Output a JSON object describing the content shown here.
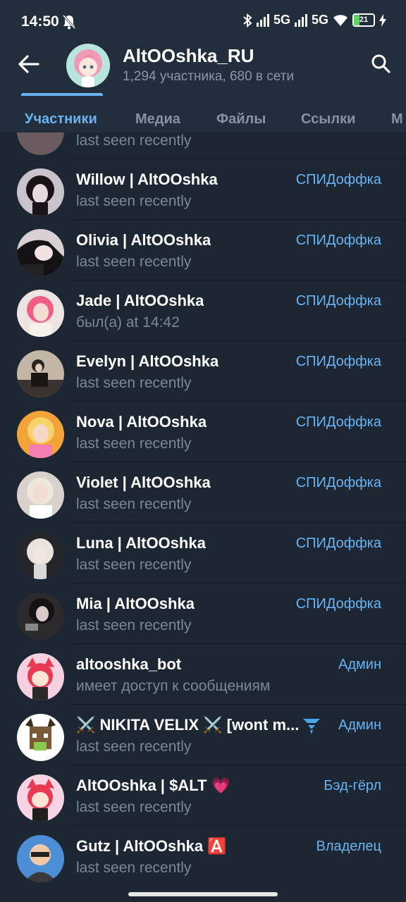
{
  "status_bar": {
    "time": "14:50",
    "network_1": "5G",
    "network_2": "5G",
    "battery": "21"
  },
  "header": {
    "title": "AltOOshka_RU",
    "subtitle": "1,294 участника, 680 в сети"
  },
  "tabs": [
    {
      "label": "Участники",
      "active": true
    },
    {
      "label": "Медиа",
      "active": false
    },
    {
      "label": "Файлы",
      "active": false
    },
    {
      "label": "Ссылки",
      "active": false
    },
    {
      "label": "М",
      "active": false
    }
  ],
  "partial_row": {
    "status": "last seen recently"
  },
  "members": [
    {
      "name": "Willow | AltOOshka",
      "status": "last seen recently",
      "role": "СПИДоффка"
    },
    {
      "name": "Olivia | AltOOshka",
      "status": "last seen recently",
      "role": "СПИДоффка"
    },
    {
      "name": "Jade | AltOOshka",
      "status": "был(а) at 14:42",
      "role": "СПИДоффка"
    },
    {
      "name": "Evelyn | AltOOshka",
      "status": "last seen recently",
      "role": "СПИДоффка"
    },
    {
      "name": "Nova | AltOOshka",
      "status": "last seen recently",
      "role": "СПИДоффка"
    },
    {
      "name": "Violet | AltOOshka",
      "status": "last seen recently",
      "role": "СПИДоффка"
    },
    {
      "name": "Luna | AltOOshka",
      "status": "last seen recently",
      "role": "СПИДоффка"
    },
    {
      "name": "Mia | AltOOshka",
      "status": "last seen recently",
      "role": "СПИДоффка"
    },
    {
      "name": "altooshka_bot",
      "status": "имеет доступ к сообщениям",
      "role": "Админ"
    },
    {
      "name": "⚔️ NIKITA VELIX ⚔️ [wont m...",
      "status": "last seen recently",
      "role": "Админ"
    },
    {
      "name": "AltOOshka | $ALT 💗",
      "status": "last seen recently",
      "role": "Бэд-гёрл"
    },
    {
      "name": "Gutz | AltOOshka 🅰️",
      "status": "last seen recently",
      "role": "Владелец"
    }
  ],
  "colors": {
    "background": "#1d2733",
    "header": "#232e3c",
    "accent": "#6ab3f3",
    "secondary_text": "#7b8896"
  }
}
